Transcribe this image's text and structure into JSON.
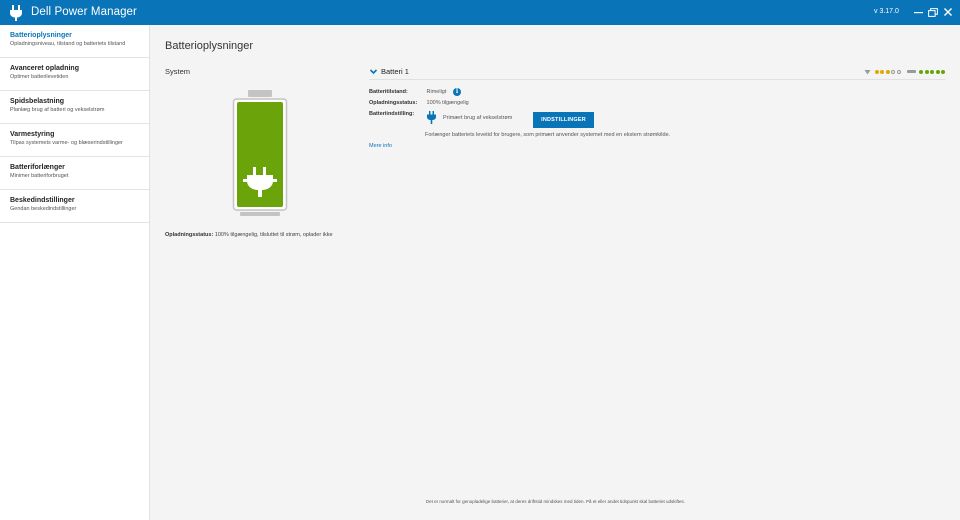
{
  "window": {
    "title": "Dell Power Manager",
    "version": "v 3.17.0"
  },
  "sidebar": {
    "items": [
      {
        "title": "Batterioplysninger",
        "subtitle": "Opladningsniveau, tilstand og batteriets tilstand"
      },
      {
        "title": "Avanceret opladning",
        "subtitle": "Optimer batterilevetiden"
      },
      {
        "title": "Spidsbelastning",
        "subtitle": "Planlæg brug af batteri og vekselstrøm"
      },
      {
        "title": "Varmestyring",
        "subtitle": "Tilpas systemets varme- og blæserindstillinger"
      },
      {
        "title": "Batteriforlænger",
        "subtitle": "Minimer batteriforbruget"
      },
      {
        "title": "Beskedindstillinger",
        "subtitle": "Gendan beskedindstillinger"
      }
    ]
  },
  "main": {
    "title": "Batterioplysninger",
    "system_label": "System",
    "battery_level": 1.0,
    "battery_color": "#6aa30a",
    "status_label": "Opladningsstatus:",
    "status_value": "100% tilgængelig, tilsluttet til strøm, oplader ikke"
  },
  "battery_panel": {
    "title": "Batteri 1",
    "health_label": "Batteritilstand:",
    "health_value": "Rimeligt",
    "charge_label": "Opladningsstatus:",
    "charge_value": "100% tilgængelig",
    "setting_label": "Batteriindstilling:",
    "setting_value": "Primært brug af vekselstrøm",
    "settings_button": "INDSTILLINGER",
    "description": "Forlænger batteriets levetid for brugere, som primært anvender systemet med en ekstern strømkilde.",
    "more_info": "Mere info",
    "health_dots": {
      "filled": 3,
      "total": 5,
      "color": "#e0a800"
    },
    "charge_dots": {
      "filled": 5,
      "total": 5,
      "color": "#6aa30a"
    }
  },
  "footer": {
    "note": "Det er normalt for genopladelige batterier, at deres driftstid mindskes med tiden. På et eller andet tidspunkt skal batteriet udskiftes."
  },
  "colors": {
    "accent": "#0a74b9",
    "battery_green": "#6aa30a"
  },
  "icons": {
    "app": "plug-icon",
    "minimize": "minimize-icon",
    "maximize": "restore-icon",
    "close": "close-icon",
    "info": "info-icon",
    "collapse": "chevron-down-icon"
  }
}
